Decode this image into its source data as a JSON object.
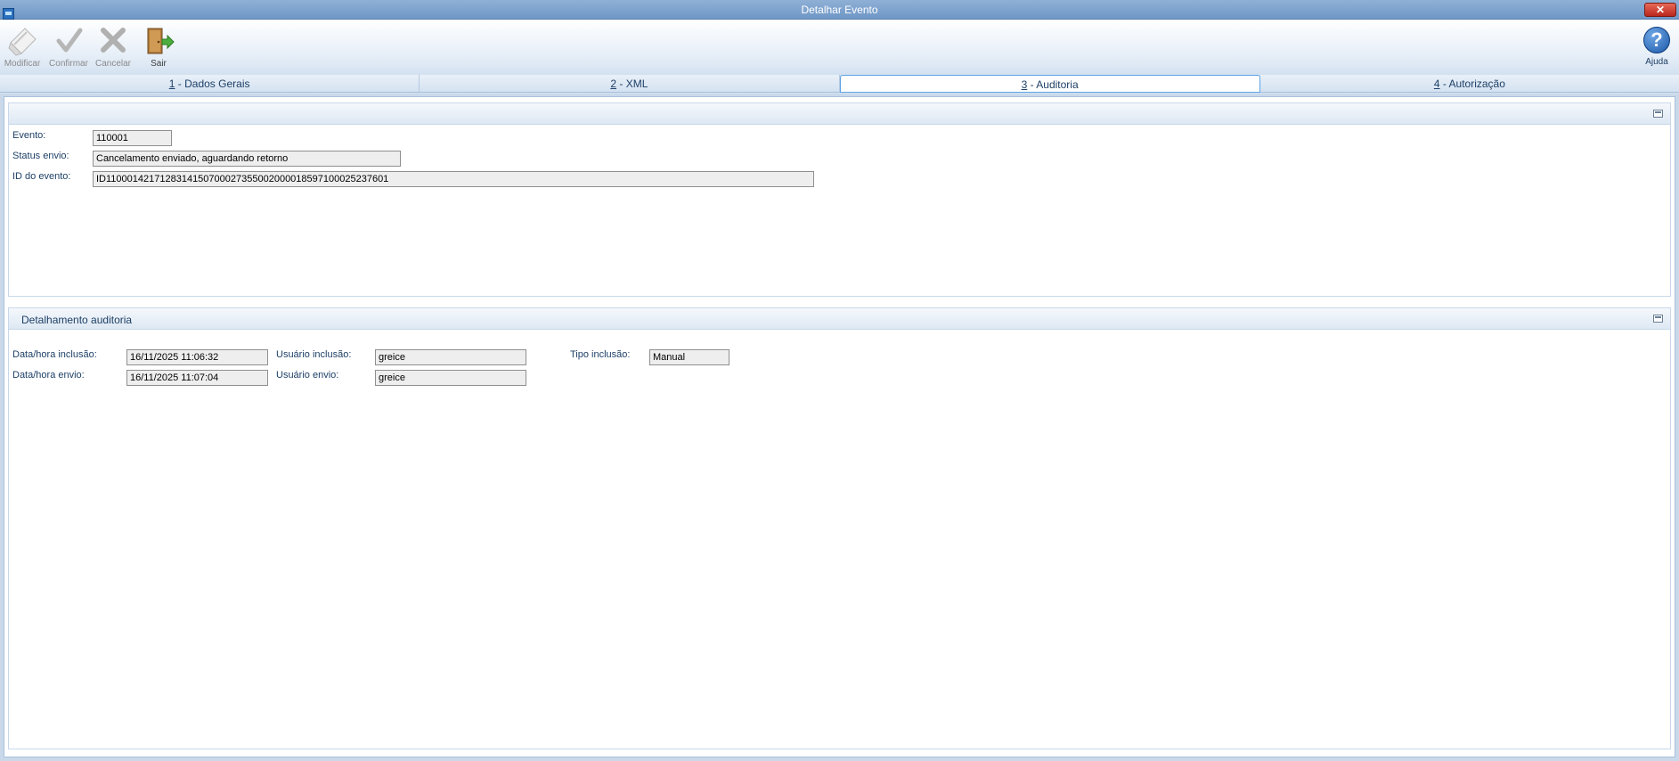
{
  "window": {
    "title": "Detalhar Evento",
    "close_symbol": "✕"
  },
  "toolbar": {
    "modify_label": "Modificar",
    "confirm_label": "Confirmar",
    "cancel_label": "Cancelar",
    "exit_label": "Sair",
    "help_label": "Ajuda",
    "help_symbol": "?"
  },
  "tabs": [
    {
      "key": "1",
      "label": " - Dados Gerais"
    },
    {
      "key": "2",
      "label": " - XML"
    },
    {
      "key": "3",
      "label": " - Auditoria"
    },
    {
      "key": "4",
      "label": " - Autorização"
    }
  ],
  "active_tab": 3,
  "event_panel": {
    "evento_label": "Evento:",
    "evento_value": "110001",
    "status_label": "Status envio:",
    "status_value": "Cancelamento enviado, aguardando retorno",
    "id_label": "ID do evento:",
    "id_value": "ID1100014217128314150700027355002000018597100025237601"
  },
  "audit_panel": {
    "title": "Detalhamento auditoria",
    "inclusao_date_label": "Data/hora inclusão:",
    "inclusao_date_value": "16/11/2025 11:06:32",
    "envio_date_label": "Data/hora envio:",
    "envio_date_value": "16/11/2025 11:07:04",
    "inclusao_user_label": "Usuário inclusão:",
    "inclusao_user_value": "greice",
    "envio_user_label": "Usuário envio:",
    "envio_user_value": "greice",
    "tipo_label": "Tipo inclusão:",
    "tipo_value": "Manual"
  },
  "colors": {
    "label_text": "#1d3f66",
    "active_tab_border": "#5ea3e6",
    "titlebar": "#7da3ce"
  }
}
